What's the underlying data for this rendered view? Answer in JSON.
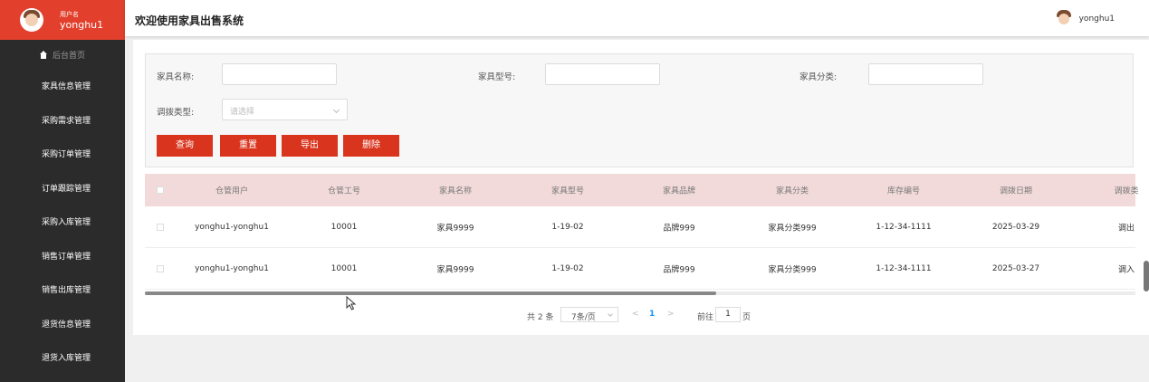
{
  "sidebar": {
    "user_label": "用户名",
    "user_name": "yonghu1",
    "home_label": "后台首页",
    "items": [
      {
        "label": "家具信息管理"
      },
      {
        "label": "采购需求管理"
      },
      {
        "label": "采购订单管理"
      },
      {
        "label": "订单跟踪管理"
      },
      {
        "label": "采购入库管理"
      },
      {
        "label": "销售订单管理"
      },
      {
        "label": "销售出库管理"
      },
      {
        "label": "退货信息管理"
      },
      {
        "label": "退货入库管理"
      }
    ]
  },
  "header": {
    "title": "欢迎使用家具出售系统",
    "user_name": "yonghu1"
  },
  "search": {
    "name_label": "家具名称:",
    "model_label": "家具型号:",
    "category_label": "家具分类:",
    "type_label": "调拨类型:",
    "type_placeholder": "请选择",
    "buttons": {
      "query": "查询",
      "reset": "重置",
      "export": "导出",
      "delete": "删除"
    }
  },
  "table": {
    "headers": [
      "仓管用户",
      "仓管工号",
      "家具名称",
      "家具型号",
      "家具品牌",
      "家具分类",
      "库存编号",
      "调拨日期",
      "调拨类"
    ],
    "rows": [
      [
        "yonghu1-yonghu1",
        "10001",
        "家具9999",
        "1-19-02",
        "品牌999",
        "家具分类999",
        "1-12-34-1111",
        "2025-03-29",
        "调出"
      ],
      [
        "yonghu1-yonghu1",
        "10001",
        "家具9999",
        "1-19-02",
        "品牌999",
        "家具分类999",
        "1-12-34-1111",
        "2025-03-27",
        "调入"
      ]
    ]
  },
  "pagination": {
    "total": "共 2 条",
    "page_size": "7条/页",
    "prev": "<",
    "current_page": "1",
    "next": ">",
    "goto": "前往",
    "goto_value": "1",
    "page_unit": "页"
  },
  "colors": {
    "accent": "#d9351e",
    "sidebar_bg": "#2b2b2b",
    "table_header_bg": "#f3dada",
    "link": "#1890ff"
  }
}
